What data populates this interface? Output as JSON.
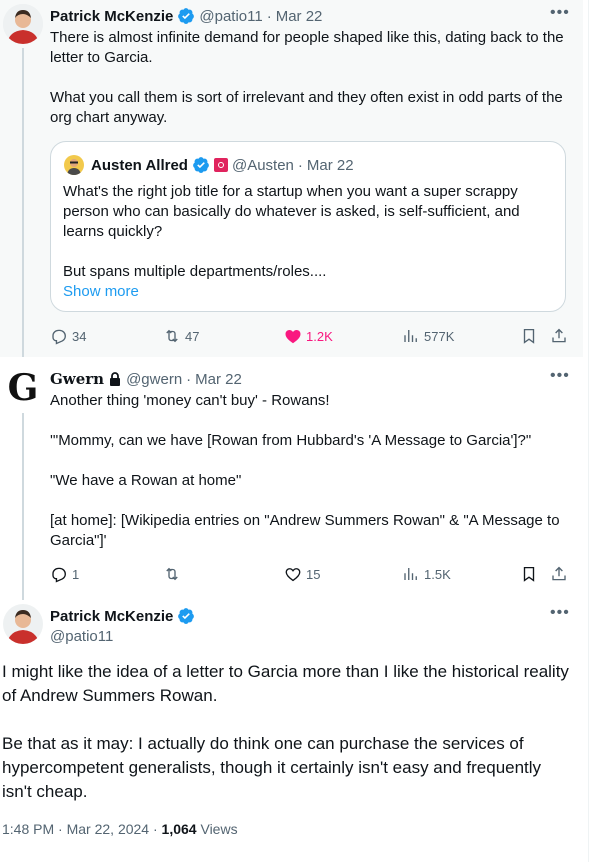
{
  "tweet1": {
    "author_name": "Patrick McKenzie",
    "handle": "@patio11",
    "separator": "·",
    "date": "Mar 22",
    "text": "There is almost infinite demand for people shaped like this, dating back to the letter to Garcia.\n\nWhat you call them is sort of irrelevant and they often exist in odd parts of the org chart anyway.",
    "quote": {
      "author_name": "Austen Allred",
      "handle": "@Austen",
      "separator": "·",
      "date": "Mar 22",
      "text": "What's the right job title for a startup when you want a super scrappy person who can basically do whatever is asked, is self-sufficient, and learns quickly?\n\nBut spans multiple departments/roles....",
      "show_more": "Show more"
    },
    "stats": {
      "replies": "34",
      "reposts": "47",
      "likes": "1.2K",
      "views": "577K"
    }
  },
  "tweet2": {
    "author_name": "Gwern",
    "handle": "@gwern",
    "separator": "·",
    "date": "Mar 22",
    "text": "Another thing 'money can't buy' - Rowans!\n\n'\"Mommy, can we have [Rowan from Hubbard's 'A Message to Garcia']?\"\n\n\"We have a Rowan at home\"\n\n[at home]: [Wikipedia entries on \"Andrew Summers Rowan\" & \"A Message to Garcia\"]'",
    "stats": {
      "replies": "1",
      "reposts": "",
      "likes": "15",
      "views": "1.5K"
    }
  },
  "tweet3": {
    "author_name": "Patrick McKenzie",
    "handle": "@patio11",
    "text": "I might like the idea of a letter to Garcia more than I like the historical reality of Andrew Summers Rowan.\n\nBe that as it may: I actually do think one can purchase the services of hypercompetent generalists, though it certainly isn't easy and frequently isn't cheap.",
    "time": "1:48 PM",
    "meta_separator": "·",
    "full_date": "Mar 22, 2024",
    "views_count": "1,064",
    "views_label": "Views"
  },
  "colors": {
    "verified": "#1d9bf0",
    "like": "#f91880",
    "link": "#1d9bf0",
    "muted": "#536471"
  },
  "icons": [
    "verified-badge-icon",
    "lock-icon",
    "reply-icon",
    "repost-icon",
    "heart-icon",
    "views-icon",
    "bookmark-icon",
    "share-icon",
    "more-icon"
  ]
}
